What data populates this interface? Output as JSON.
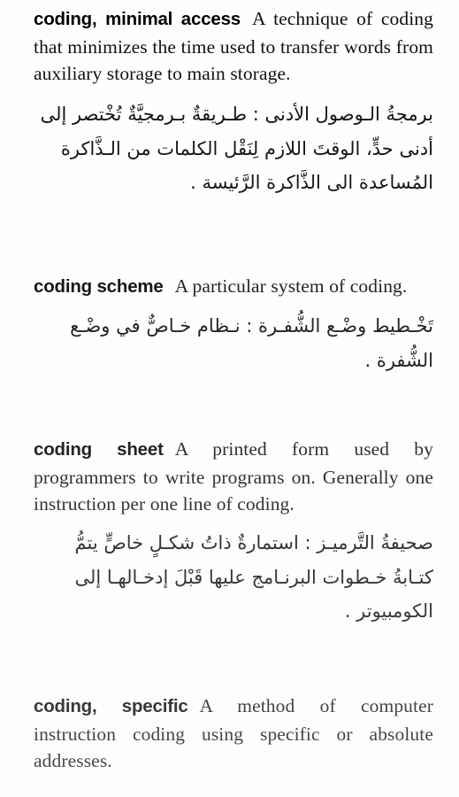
{
  "page": {
    "background_color": "#fefefe",
    "text_color": "#0d0d0d",
    "artifact_speck": "."
  },
  "entries": [
    {
      "headword": "coding, minimal access",
      "english_definition": "A technique of coding that minimizes the time used to transfer words from auxiliary storage to main storage.",
      "arabic_lines": [
        "برمجةُ الـوصول الأدنى : طـريقةٌ بـرمجيَّةٌ تُخْتصر إلى",
        "أدنى حدٍّ، الوقتَ اللازم لِنَقْل الكلمات من الـذَّاكرة",
        "المُساعدة الى الذَّاكرة الرَّئيسة ."
      ]
    },
    {
      "headword": "coding scheme",
      "english_definition": "A particular system of coding.",
      "arabic_lines": [
        "تَخْـطيط وضْـع الشُّفـرة : نـظام خـاصٌّ في وضْـع",
        "الشُّفرة ."
      ]
    },
    {
      "headword": "coding sheet",
      "english_definition": "A printed form used by programmers to write programs on. Generally one instruction per one line of coding.",
      "arabic_lines": [
        "صحيفةُ التَّرميـز : استمارةٌ ذاتُ شكـلٍ خاصٍّ يتمُّ",
        "كتـابةُ خـطوات البرنـامج عليها قَبْلَ إدخـالهـا إلى",
        "الكومبيوتر ."
      ]
    },
    {
      "headword": "coding, specific",
      "english_definition": "A method of computer instruction coding using specific or absolute addresses.",
      "arabic_lines": []
    }
  ]
}
